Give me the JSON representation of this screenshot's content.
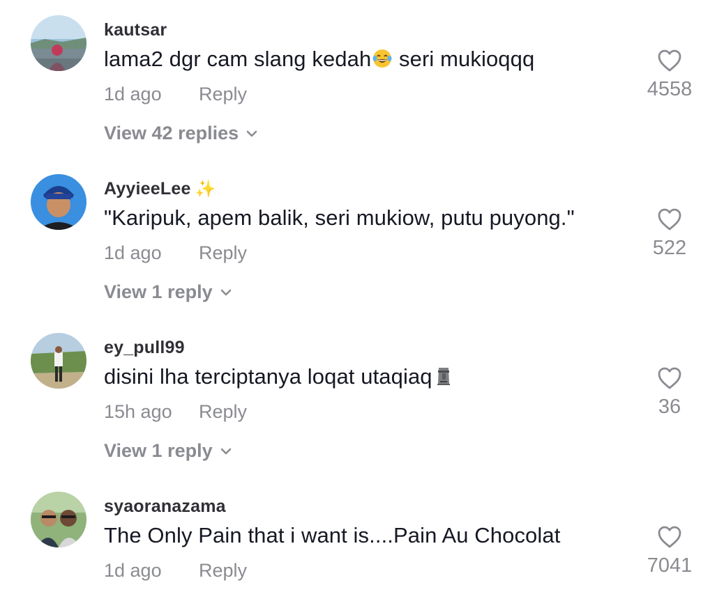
{
  "comments": [
    {
      "username": "kautsar",
      "text": "lama2 dgr cam slang kedah",
      "emoji": "tears-of-joy-emoji",
      "text_after": " seri mukioqqq",
      "time": "1d ago",
      "reply_label": "Reply",
      "likes": "4558",
      "view_replies": "View 42 replies"
    },
    {
      "username": "AyyieeLee",
      "badge": "✨",
      "text": "\"Karipuk, apem balik, seri mukiow, putu puyong.\"",
      "time": "1d ago",
      "reply_label": "Reply",
      "likes": "522",
      "view_replies": "View 1 reply"
    },
    {
      "username": "ey_pull99",
      "text": "disini lha terciptanya loqat utaqiaq",
      "emoji": "moai-emoji",
      "time": "15h ago",
      "reply_label": "Reply",
      "likes": "36",
      "view_replies": "View 1 reply"
    },
    {
      "username": "syaoranazama",
      "text": "The Only Pain that i want is....Pain Au Chocolat",
      "time": "1d ago",
      "reply_label": "Reply",
      "likes": "7041"
    }
  ],
  "icons": {
    "like": "heart-outline-icon",
    "expand": "chevron-down-icon"
  },
  "colors": {
    "text": "#161823",
    "muted": "#8a8b91",
    "username": "#2f2f35"
  }
}
